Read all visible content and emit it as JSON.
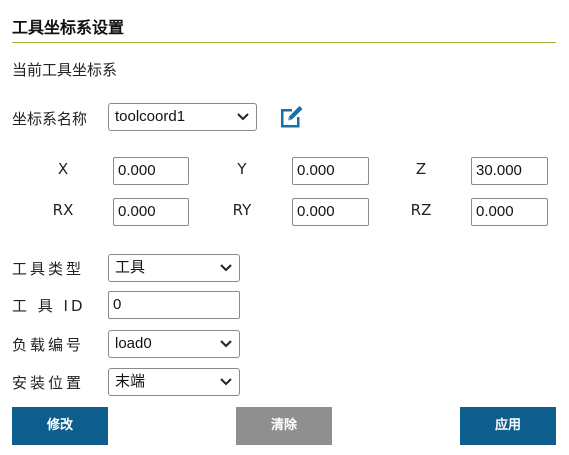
{
  "header": {
    "title": "工具坐标系设置"
  },
  "subtitle": "当前工具坐标系",
  "coord_name": {
    "label": "坐标系名称",
    "value": "toolcoord1"
  },
  "pose": {
    "x": {
      "label": "X",
      "value": "0.000"
    },
    "y": {
      "label": "Y",
      "value": "0.000"
    },
    "z": {
      "label": "Z",
      "value": "30.000"
    },
    "rx": {
      "label": "RX",
      "value": "0.000"
    },
    "ry": {
      "label": "RY",
      "value": "0.000"
    },
    "rz": {
      "label": "RZ",
      "value": "0.000"
    }
  },
  "tool_type": {
    "label": "工具类型",
    "value": "工具"
  },
  "tool_id": {
    "label": "工 具 ID",
    "value": "0"
  },
  "load_no": {
    "label": "负载编号",
    "value": "load0"
  },
  "install_pos": {
    "label": "安装位置",
    "value": "末端"
  },
  "buttons": {
    "modify": "修改",
    "clear": "清除",
    "apply": "应用"
  },
  "colors": {
    "accent_line": "#a7b63a",
    "button_blue": "#0d5e8c",
    "button_gray": "#8f8f8f",
    "icon_blue": "#1a6fa8"
  }
}
